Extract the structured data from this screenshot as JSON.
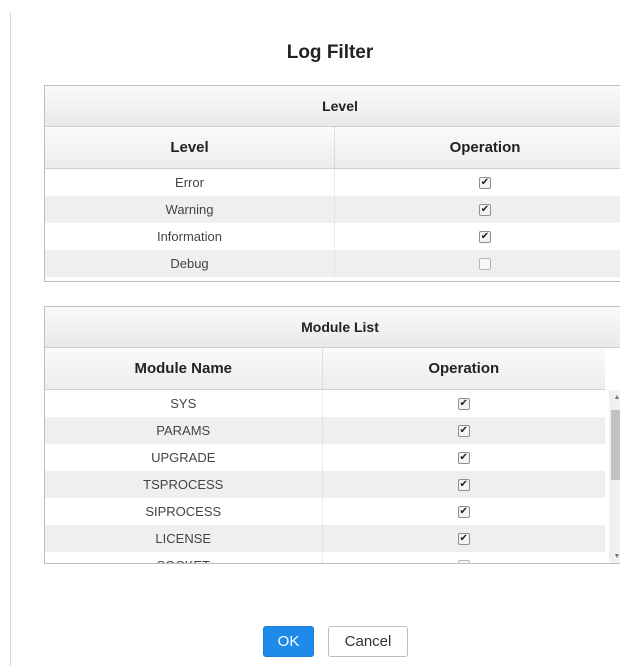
{
  "dialog": {
    "title": "Log Filter"
  },
  "level_panel": {
    "caption": "Level",
    "columns": [
      "Level",
      "Operation"
    ],
    "rows": [
      {
        "name": "Error",
        "checked": true
      },
      {
        "name": "Warning",
        "checked": true
      },
      {
        "name": "Information",
        "checked": true
      },
      {
        "name": "Debug",
        "checked": false
      }
    ]
  },
  "module_panel": {
    "caption": "Module List",
    "columns": [
      "Module Name",
      "Operation"
    ],
    "rows": [
      {
        "name": "SYS",
        "checked": true
      },
      {
        "name": "PARAMS",
        "checked": true
      },
      {
        "name": "UPGRADE",
        "checked": true
      },
      {
        "name": "TSPROCESS",
        "checked": true
      },
      {
        "name": "SIPROCESS",
        "checked": true
      },
      {
        "name": "LICENSE",
        "checked": true
      },
      {
        "name": "SOCKET",
        "checked": false
      }
    ]
  },
  "buttons": {
    "ok_label": "OK",
    "cancel_label": "Cancel"
  },
  "icons": {
    "checkbox": "checkbox-icon",
    "scroll_up": "scroll-up-arrow-icon",
    "scroll_down": "scroll-down-arrow-icon"
  },
  "colors": {
    "primary_button": "#1e8bea",
    "zebra_row": "#efefef"
  }
}
